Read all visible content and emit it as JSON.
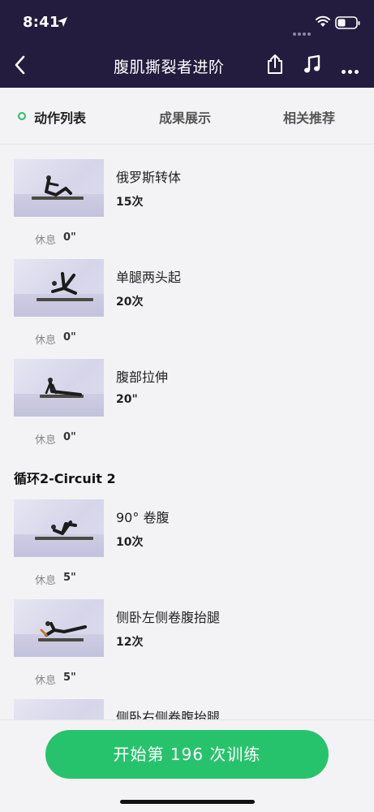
{
  "status_bar": {
    "time": "8:41",
    "icons": [
      "location-arrow-icon",
      "signal-dots-icon",
      "wifi-icon",
      "battery-icon"
    ]
  },
  "nav": {
    "title": "腹肌撕裂者进阶",
    "icons": [
      "back-icon",
      "share-icon",
      "music-icon",
      "more-icon"
    ]
  },
  "tabs": [
    {
      "label": "动作列表",
      "active": true
    },
    {
      "label": "成果展示",
      "active": false
    },
    {
      "label": "相关推荐",
      "active": false
    }
  ],
  "exercises": [
    {
      "name": "俄罗斯转体",
      "reps": "15次",
      "rest_label": "休息",
      "rest": "0\""
    },
    {
      "name": "单腿两头起",
      "reps": "20次",
      "rest_label": "休息",
      "rest": "0\""
    },
    {
      "name": "腹部拉伸",
      "reps": "20\"",
      "rest_label": "休息",
      "rest": "0\""
    }
  ],
  "circuit2": {
    "title": "循环2-Circuit 2",
    "exercises": [
      {
        "name": "90° 卷腹",
        "reps": "10次",
        "rest_label": "休息",
        "rest": "5\""
      },
      {
        "name": "侧卧左侧卷腹抬腿",
        "reps": "12次",
        "rest_label": "休息",
        "rest": "5\""
      },
      {
        "name": "侧卧右侧卷腹抬腿",
        "reps": "",
        "rest_label": "",
        "rest": ""
      }
    ]
  },
  "start_button": {
    "label": "开始第 196 次训练"
  },
  "colors": {
    "header_bg": "#231c3e",
    "accent_green": "#27c36c",
    "page_bg": "#f3f3f5"
  }
}
